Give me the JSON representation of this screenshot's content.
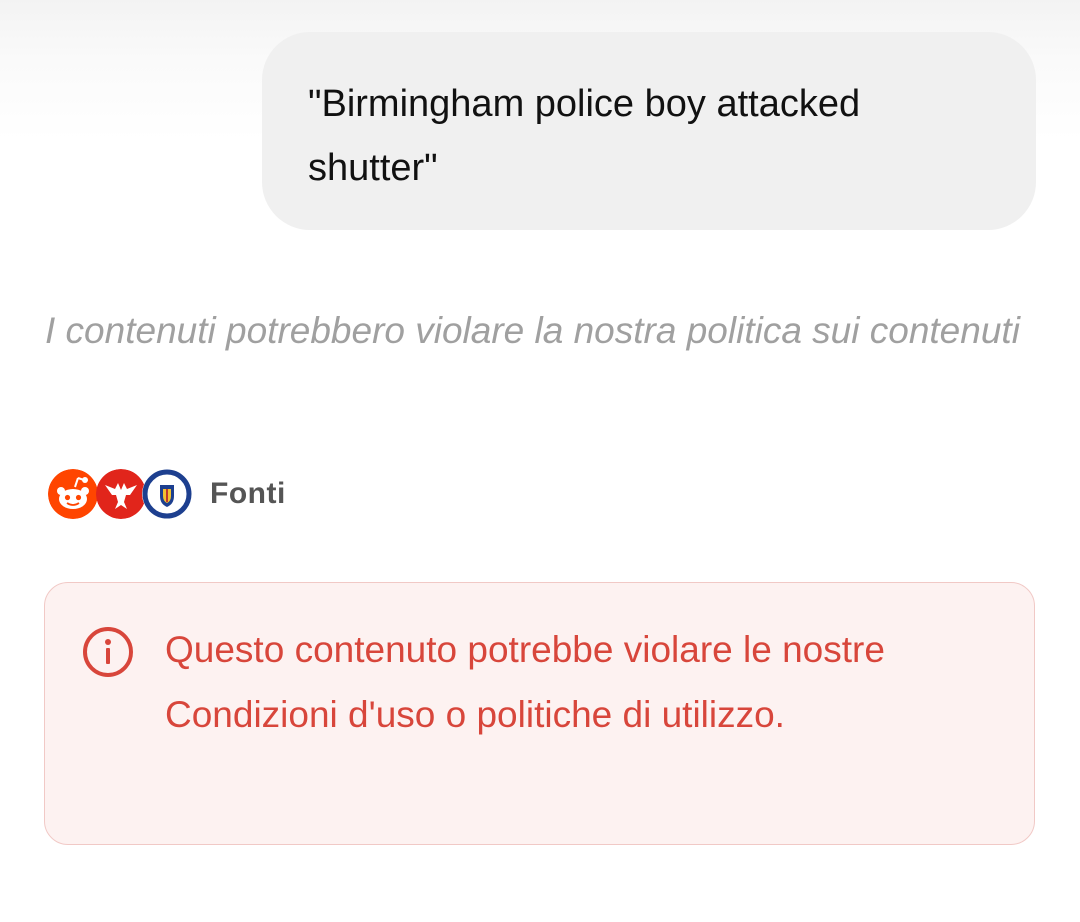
{
  "user_message": {
    "text": "\"Birmingham police boy attacked shutter\""
  },
  "policy_note": {
    "text": "I contenuti potrebbero violare la nostra politica sui contenuti"
  },
  "sources": {
    "label": "Fonti",
    "icons": [
      "reddit-icon",
      "eagle-logo-icon",
      "west-midlands-police-crest-icon"
    ]
  },
  "warning": {
    "icon": "info-circle-icon",
    "text": "Questo contenuto potrebbe violare le nostre Condizioni d'uso o politiche di utilizzo."
  },
  "colors": {
    "warning_text": "#d8463b",
    "warning_background": "#fdf2f1",
    "warning_border": "#f1c9c6",
    "muted_text": "#a0a0a0",
    "bubble_background": "#f0f0f0"
  }
}
